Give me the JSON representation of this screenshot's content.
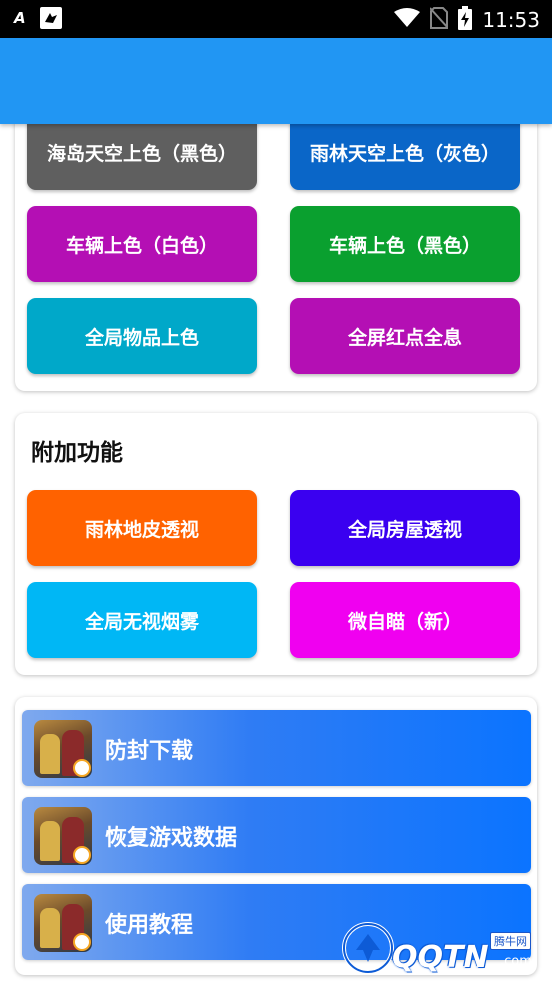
{
  "status_bar": {
    "time": "11:53",
    "left_glyph": "A",
    "icons": [
      "font-size-icon",
      "notification-bird-icon",
      "wifi-icon",
      "no-sim-icon",
      "battery-charging-icon"
    ]
  },
  "colors": {
    "app_bar": "#2196f3",
    "list_item_gradient": [
      "#7fa9ee",
      "#0b74ff"
    ]
  },
  "section1": {
    "buttons": [
      {
        "label": "海岛天空上色（黑色）",
        "color": "#5f5f5f"
      },
      {
        "label": "雨林天空上色（灰色）",
        "color": "#0a66c8"
      },
      {
        "label": "车辆上色（白色）",
        "color": "#b40fb4"
      },
      {
        "label": "车辆上色（黑色）",
        "color": "#0aa02f"
      },
      {
        "label": "全局物品上色",
        "color": "#00a8c9"
      },
      {
        "label": "全屏红点全息",
        "color": "#b40fb4"
      }
    ]
  },
  "section2": {
    "title": "附加功能",
    "buttons": [
      {
        "label": "雨林地皮透视",
        "color": "#ff6200"
      },
      {
        "label": "全局房屋透视",
        "color": "#3a00f0"
      },
      {
        "label": "全局无视烟雾",
        "color": "#00b7f5"
      },
      {
        "label": "微自瞄（新）",
        "color": "#f000f0"
      }
    ]
  },
  "section3": {
    "items": [
      {
        "label": "防封下载"
      },
      {
        "label": "恢复游戏数据"
      },
      {
        "label": "使用教程"
      }
    ]
  },
  "watermark": {
    "brand": "QQTN",
    "suffix": ".com",
    "chip": "腾牛网"
  }
}
